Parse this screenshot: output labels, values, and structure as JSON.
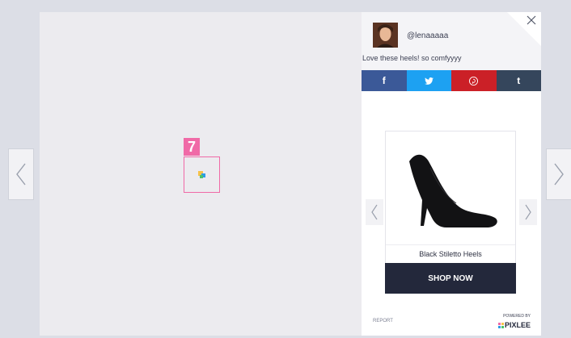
{
  "navigation": {
    "prev_label": "",
    "next_label": ""
  },
  "media": {
    "badge_number": "7"
  },
  "post": {
    "username": "@lenaaaaa",
    "caption": "Love these heels! so comfyyyy"
  },
  "share": {
    "facebook": "f",
    "twitter": "",
    "pinterest": "",
    "tumblr": "t"
  },
  "product": {
    "name": "Black Stiletto Heels",
    "cta": "SHOP NOW"
  },
  "footer": {
    "report": "REPORT",
    "powered_by": "POWERED BY",
    "brand": "PIXLEE"
  },
  "colors": {
    "facebook": "#3b5998",
    "twitter": "#1da1f2",
    "pinterest": "#cb2027",
    "tumblr": "#35465c",
    "badge": "#f06aa7",
    "cta": "#23283b"
  }
}
